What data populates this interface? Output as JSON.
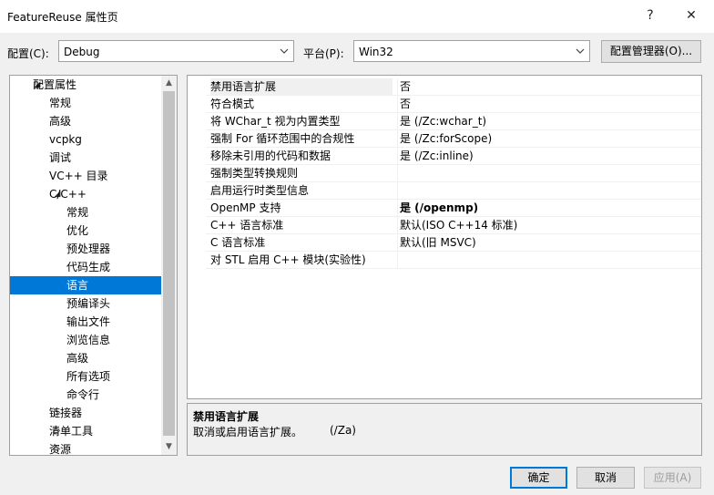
{
  "window": {
    "title": "FeatureReuse 属性页",
    "help_icon": "?",
    "close_icon": "✕"
  },
  "config": {
    "label": "配置(C):",
    "value": "Debug"
  },
  "platform": {
    "label": "平台(P):",
    "value": "Win32"
  },
  "config_manager_button": "配置管理器(O)...",
  "tree": {
    "items": [
      {
        "label": "配置属性",
        "indent": 0,
        "expander": "collapse",
        "selected": false
      },
      {
        "label": "常规",
        "indent": 1,
        "expander": "none",
        "selected": false
      },
      {
        "label": "高级",
        "indent": 1,
        "expander": "none",
        "selected": false
      },
      {
        "label": "vcpkg",
        "indent": 1,
        "expander": "none",
        "selected": false
      },
      {
        "label": "调试",
        "indent": 1,
        "expander": "none",
        "selected": false
      },
      {
        "label": "VC++ 目录",
        "indent": 1,
        "expander": "none",
        "selected": false
      },
      {
        "label": "C/C++",
        "indent": 1,
        "expander": "collapse",
        "selected": false
      },
      {
        "label": "常规",
        "indent": 2,
        "expander": "none",
        "selected": false
      },
      {
        "label": "优化",
        "indent": 2,
        "expander": "none",
        "selected": false
      },
      {
        "label": "预处理器",
        "indent": 2,
        "expander": "none",
        "selected": false
      },
      {
        "label": "代码生成",
        "indent": 2,
        "expander": "none",
        "selected": false
      },
      {
        "label": "语言",
        "indent": 2,
        "expander": "none",
        "selected": true
      },
      {
        "label": "预编译头",
        "indent": 2,
        "expander": "none",
        "selected": false
      },
      {
        "label": "输出文件",
        "indent": 2,
        "expander": "none",
        "selected": false
      },
      {
        "label": "浏览信息",
        "indent": 2,
        "expander": "none",
        "selected": false
      },
      {
        "label": "高级",
        "indent": 2,
        "expander": "none",
        "selected": false
      },
      {
        "label": "所有选项",
        "indent": 2,
        "expander": "none",
        "selected": false
      },
      {
        "label": "命令行",
        "indent": 2,
        "expander": "none",
        "selected": false
      },
      {
        "label": "链接器",
        "indent": 1,
        "expander": "expand",
        "selected": false
      },
      {
        "label": "清单工具",
        "indent": 1,
        "expander": "expand",
        "selected": false
      },
      {
        "label": "资源",
        "indent": 1,
        "expander": "expand",
        "selected": false
      }
    ]
  },
  "properties": [
    {
      "name": "禁用语言扩展",
      "value": "否",
      "bold": false,
      "active": true
    },
    {
      "name": "符合模式",
      "value": "否",
      "bold": false,
      "active": false
    },
    {
      "name": "将 WChar_t 视为内置类型",
      "value": "是 (/Zc:wchar_t)",
      "bold": false,
      "active": false
    },
    {
      "name": "强制 For 循环范围中的合规性",
      "value": "是 (/Zc:forScope)",
      "bold": false,
      "active": false
    },
    {
      "name": "移除未引用的代码和数据",
      "value": "是 (/Zc:inline)",
      "bold": false,
      "active": false
    },
    {
      "name": "强制类型转换规则",
      "value": "",
      "bold": false,
      "active": false
    },
    {
      "name": "启用运行时类型信息",
      "value": "",
      "bold": false,
      "active": false
    },
    {
      "name": "OpenMP 支持",
      "value": "是 (/openmp)",
      "bold": true,
      "active": false
    },
    {
      "name": "C++ 语言标准",
      "value": "默认(ISO C++14 标准)",
      "bold": false,
      "active": false
    },
    {
      "name": "C 语言标准",
      "value": "默认(旧 MSVC)",
      "bold": false,
      "active": false
    },
    {
      "name": "对 STL 启用 C++ 模块(实验性)",
      "value": "",
      "bold": false,
      "active": false
    }
  ],
  "description": {
    "title": "禁用语言扩展",
    "text": "取消或启用语言扩展。",
    "option": "(/Za)"
  },
  "buttons": {
    "ok": "确定",
    "cancel": "取消",
    "apply": "应用(A)"
  }
}
